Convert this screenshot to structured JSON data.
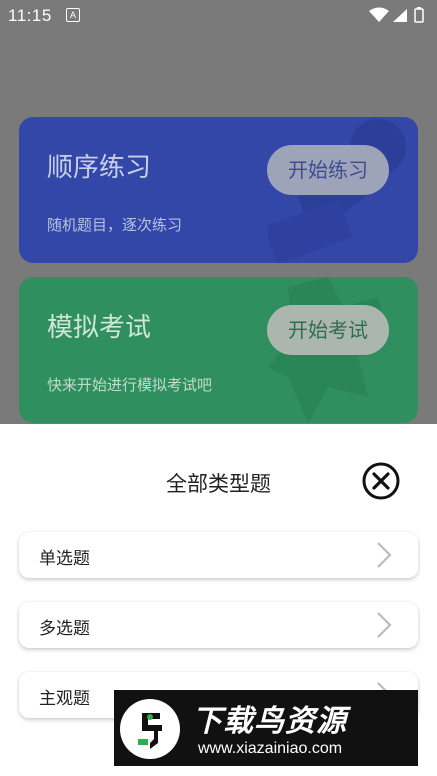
{
  "status_bar": {
    "time": "11:15",
    "notification_letter": "A"
  },
  "cards": [
    {
      "title": "顺序练习",
      "subtitle": "随机题目，逐次练习",
      "button_label": "开始练习"
    },
    {
      "title": "模拟考试",
      "subtitle": "快来开始进行模拟考试吧",
      "button_label": "开始考试"
    }
  ],
  "sheet": {
    "title": "全部类型题",
    "items": [
      {
        "label": "单选题"
      },
      {
        "label": "多选题"
      },
      {
        "label": "主观题"
      }
    ]
  },
  "watermark": {
    "title": "下载鸟资源",
    "url": "www.xiazainiao.com"
  },
  "icons": {
    "close": "close-circle-icon",
    "chevron": "chevron-right-icon"
  }
}
